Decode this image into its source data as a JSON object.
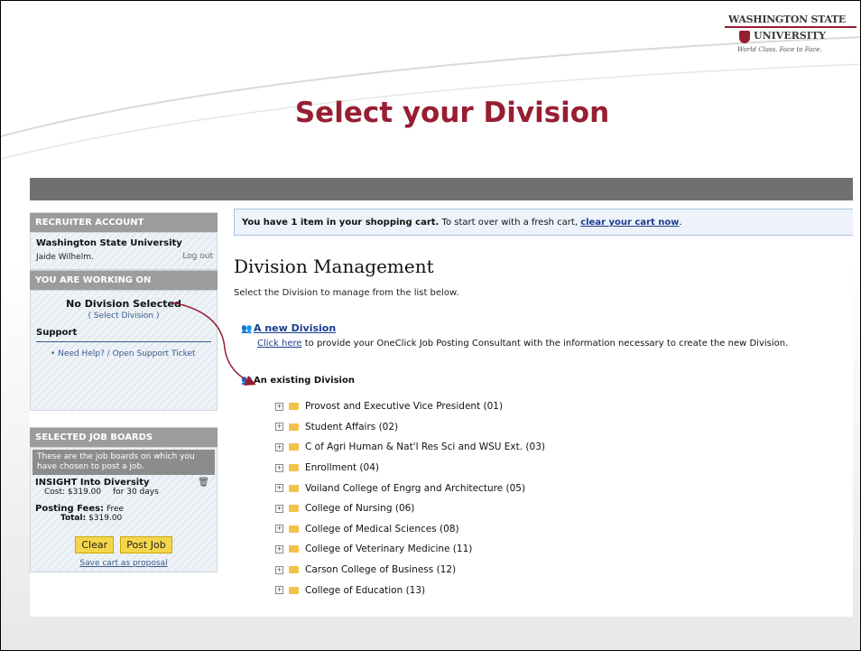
{
  "slide": {
    "title": "Select your Division",
    "logo": {
      "line1": "WASHINGTON STATE",
      "line2": "UNIVERSITY",
      "tagline": "World Class. Face to Face."
    }
  },
  "left": {
    "recruiter_account": "RECRUITER ACCOUNT",
    "org": "Washington State University",
    "user": "Jaide Wilhelm.",
    "logout": "Log out",
    "working_on": "YOU ARE WORKING ON",
    "no_division": "No Division Selected",
    "select_division": "( Select Division )",
    "support": "Support",
    "help_link": "Need Help? / Open Support Ticket",
    "selected_boards": "SELECTED JOB BOARDS",
    "boards_note": "These are the job boards on which you have chosen to post a job.",
    "board_name": "INSIGHT Into Diversity",
    "board_cost": "Cost: $319.00",
    "board_days": "for 30 days",
    "posting_fees_label": "Posting Fees:",
    "posting_fees_value": "Free",
    "total_label": "Total:",
    "total_value": "$319.00",
    "clear_btn": "Clear",
    "post_btn": "Post Job",
    "save_cart": "Save cart as proposal"
  },
  "main": {
    "cart_bold": "You have 1 item in your shopping cart.",
    "cart_text": " To start over with a fresh cart, ",
    "cart_link": "clear your cart now",
    "cart_end": ".",
    "heading": "Division Management",
    "subheading": "Select the Division to manage from the list below.",
    "new_division": "A new Division",
    "click_here": "Click here",
    "click_rest": " to provide your OneClick Job Posting Consultant with the information necessary to create the new Division.",
    "existing_division": "An existing Division",
    "divisions": [
      "Provost and Executive Vice President (01)",
      "Student Affairs (02)",
      "C of Agri Human & Nat'l Res Sci and WSU Ext. (03)",
      "Enrollment (04)",
      "Voiland College of Engrg and Architecture (05)",
      "College of Nursing (06)",
      "College of Medical Sciences (08)",
      "College of Veterinary Medicine (11)",
      "Carson College of Business (12)",
      "College of Education (13)"
    ]
  },
  "colors": {
    "title": "#981e32",
    "link": "#1a3d8f",
    "button": "#f5d64a"
  }
}
